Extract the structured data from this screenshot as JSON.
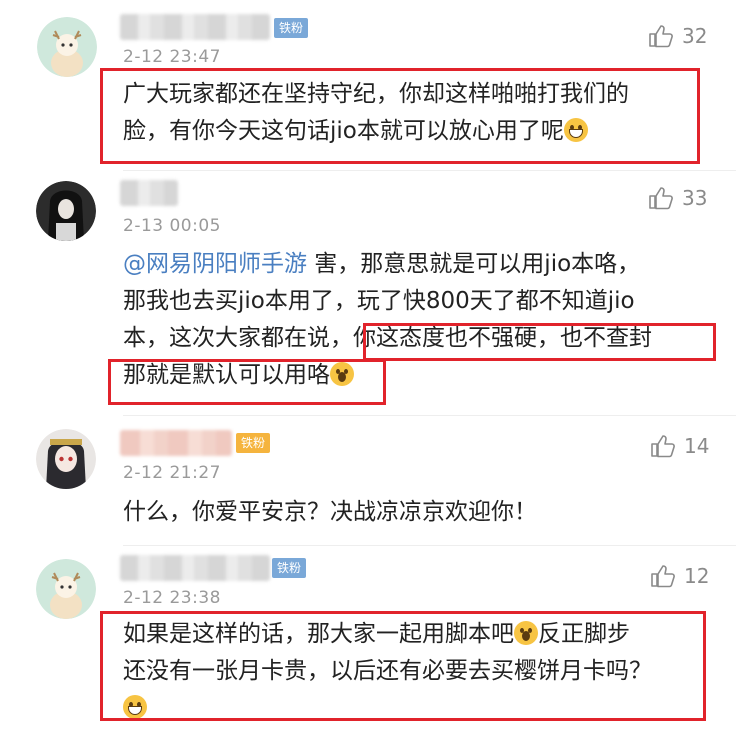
{
  "comments": [
    {
      "badge": "铁粉",
      "time": "2-12 23:47",
      "likes": "32",
      "lines": [
        "广大玩家都还在坚持守纪，你却这样啪啪打我们的",
        "脸，有你今天这句话jio本就可以放心用了呢"
      ]
    },
    {
      "time": "2-13 00:05",
      "likes": "33",
      "mention": "@网易阴阳师手游",
      "lines": [
        " 害，那意思就是可以用jio本咯，",
        "那我也去买jio本用了，玩了快800天了都不知道jio",
        "本，这次大家都在说，",
        "你这态度也不强硬，也不查封",
        "那就是默认可以用咯"
      ]
    },
    {
      "badge": "铁粉",
      "time": "2-12 21:27",
      "likes": "14",
      "lines": [
        "什么，你爱平安京？决战凉凉京欢迎你！"
      ]
    },
    {
      "badge": "铁粉",
      "time": "2-12 23:38",
      "likes": "12",
      "lines": [
        "如果是这样的话，那大家一起用脚本吧",
        "反正脚步",
        "还没有一张月卡贵，以后还有必要去买樱饼月卡吗？"
      ]
    }
  ],
  "colors": {
    "highlight_box": "#e1232b",
    "mention": "#4a7fc1",
    "badge_blue": "#7aa8d8",
    "badge_gold": "#f5b43e"
  }
}
